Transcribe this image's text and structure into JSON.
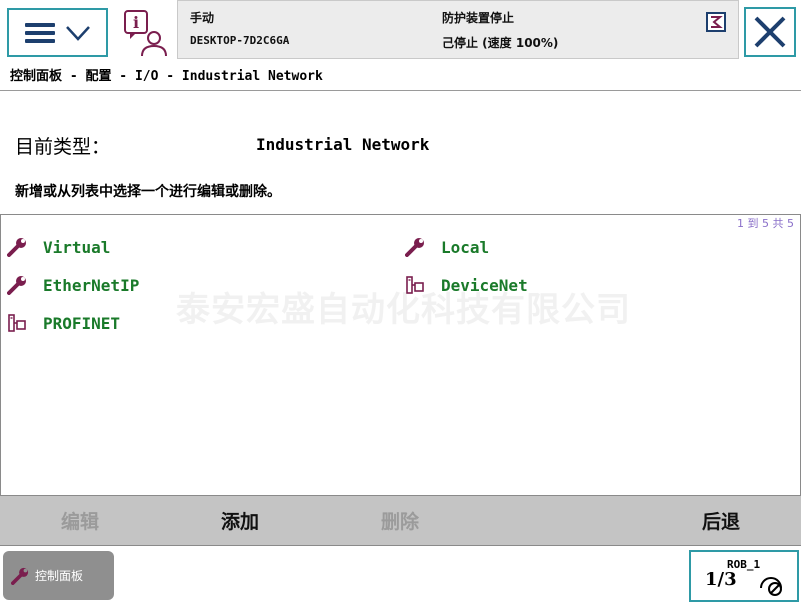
{
  "status": {
    "mode": "手动",
    "host": "DESKTOP-7D2C6GA",
    "guard": "防护装置停止",
    "run_state": "己停止 (速度 100%)"
  },
  "breadcrumb": "控制面板 - 配置 - I/O - Industrial Network",
  "type_label": "目前类型：",
  "type_value": "Industrial Network",
  "instruction": "新增或从列表中选择一个进行编辑或删除。",
  "pager": "1 到 5 共 5",
  "items": [
    {
      "label": "Virtual",
      "icon": "wrench-icon"
    },
    {
      "label": "Local",
      "icon": "wrench-icon"
    },
    {
      "label": "EtherNetIP",
      "icon": "wrench-icon"
    },
    {
      "label": "DeviceNet",
      "icon": "network-device-icon"
    },
    {
      "label": "PROFINET",
      "icon": "network-device-icon"
    }
  ],
  "watermark": "泰安宏盛自动化科技有限公司",
  "commands": {
    "edit": "编辑",
    "add": "添加",
    "delete": "删除",
    "back": "后退"
  },
  "taskbar": {
    "control_panel": "控制面板",
    "rob": "ROB_1",
    "fraction": "1/3"
  },
  "colors": {
    "accent": "#2e9aa6",
    "item_text": "#1a7a2a",
    "wrench": "#7a1e4e"
  }
}
